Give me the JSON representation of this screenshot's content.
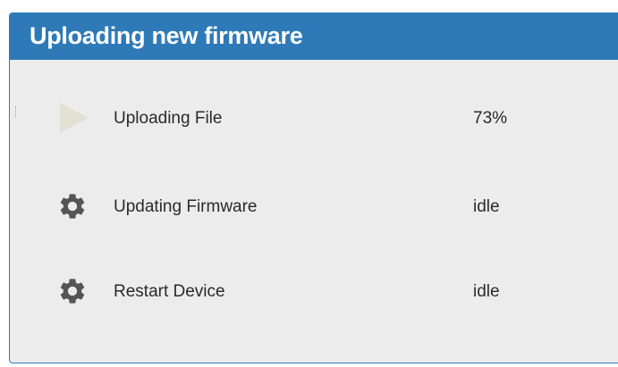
{
  "dialog": {
    "title": "Uploading new firmware"
  },
  "steps": [
    {
      "label": "Uploading File",
      "status": "73%",
      "icon": "play-icon",
      "icon_color": "#e2e2d4"
    },
    {
      "label": "Updating Firmware",
      "status": "idle",
      "icon": "gear-icon",
      "icon_color": "#555555"
    },
    {
      "label": "Restart Device",
      "status": "idle",
      "icon": "gear-icon",
      "icon_color": "#555555"
    }
  ],
  "colors": {
    "header": "#2e7ab8",
    "border": "#2f7bbd",
    "body_background": "#ececec",
    "title_text": "#ffffff",
    "text": "#2a2a2a"
  }
}
